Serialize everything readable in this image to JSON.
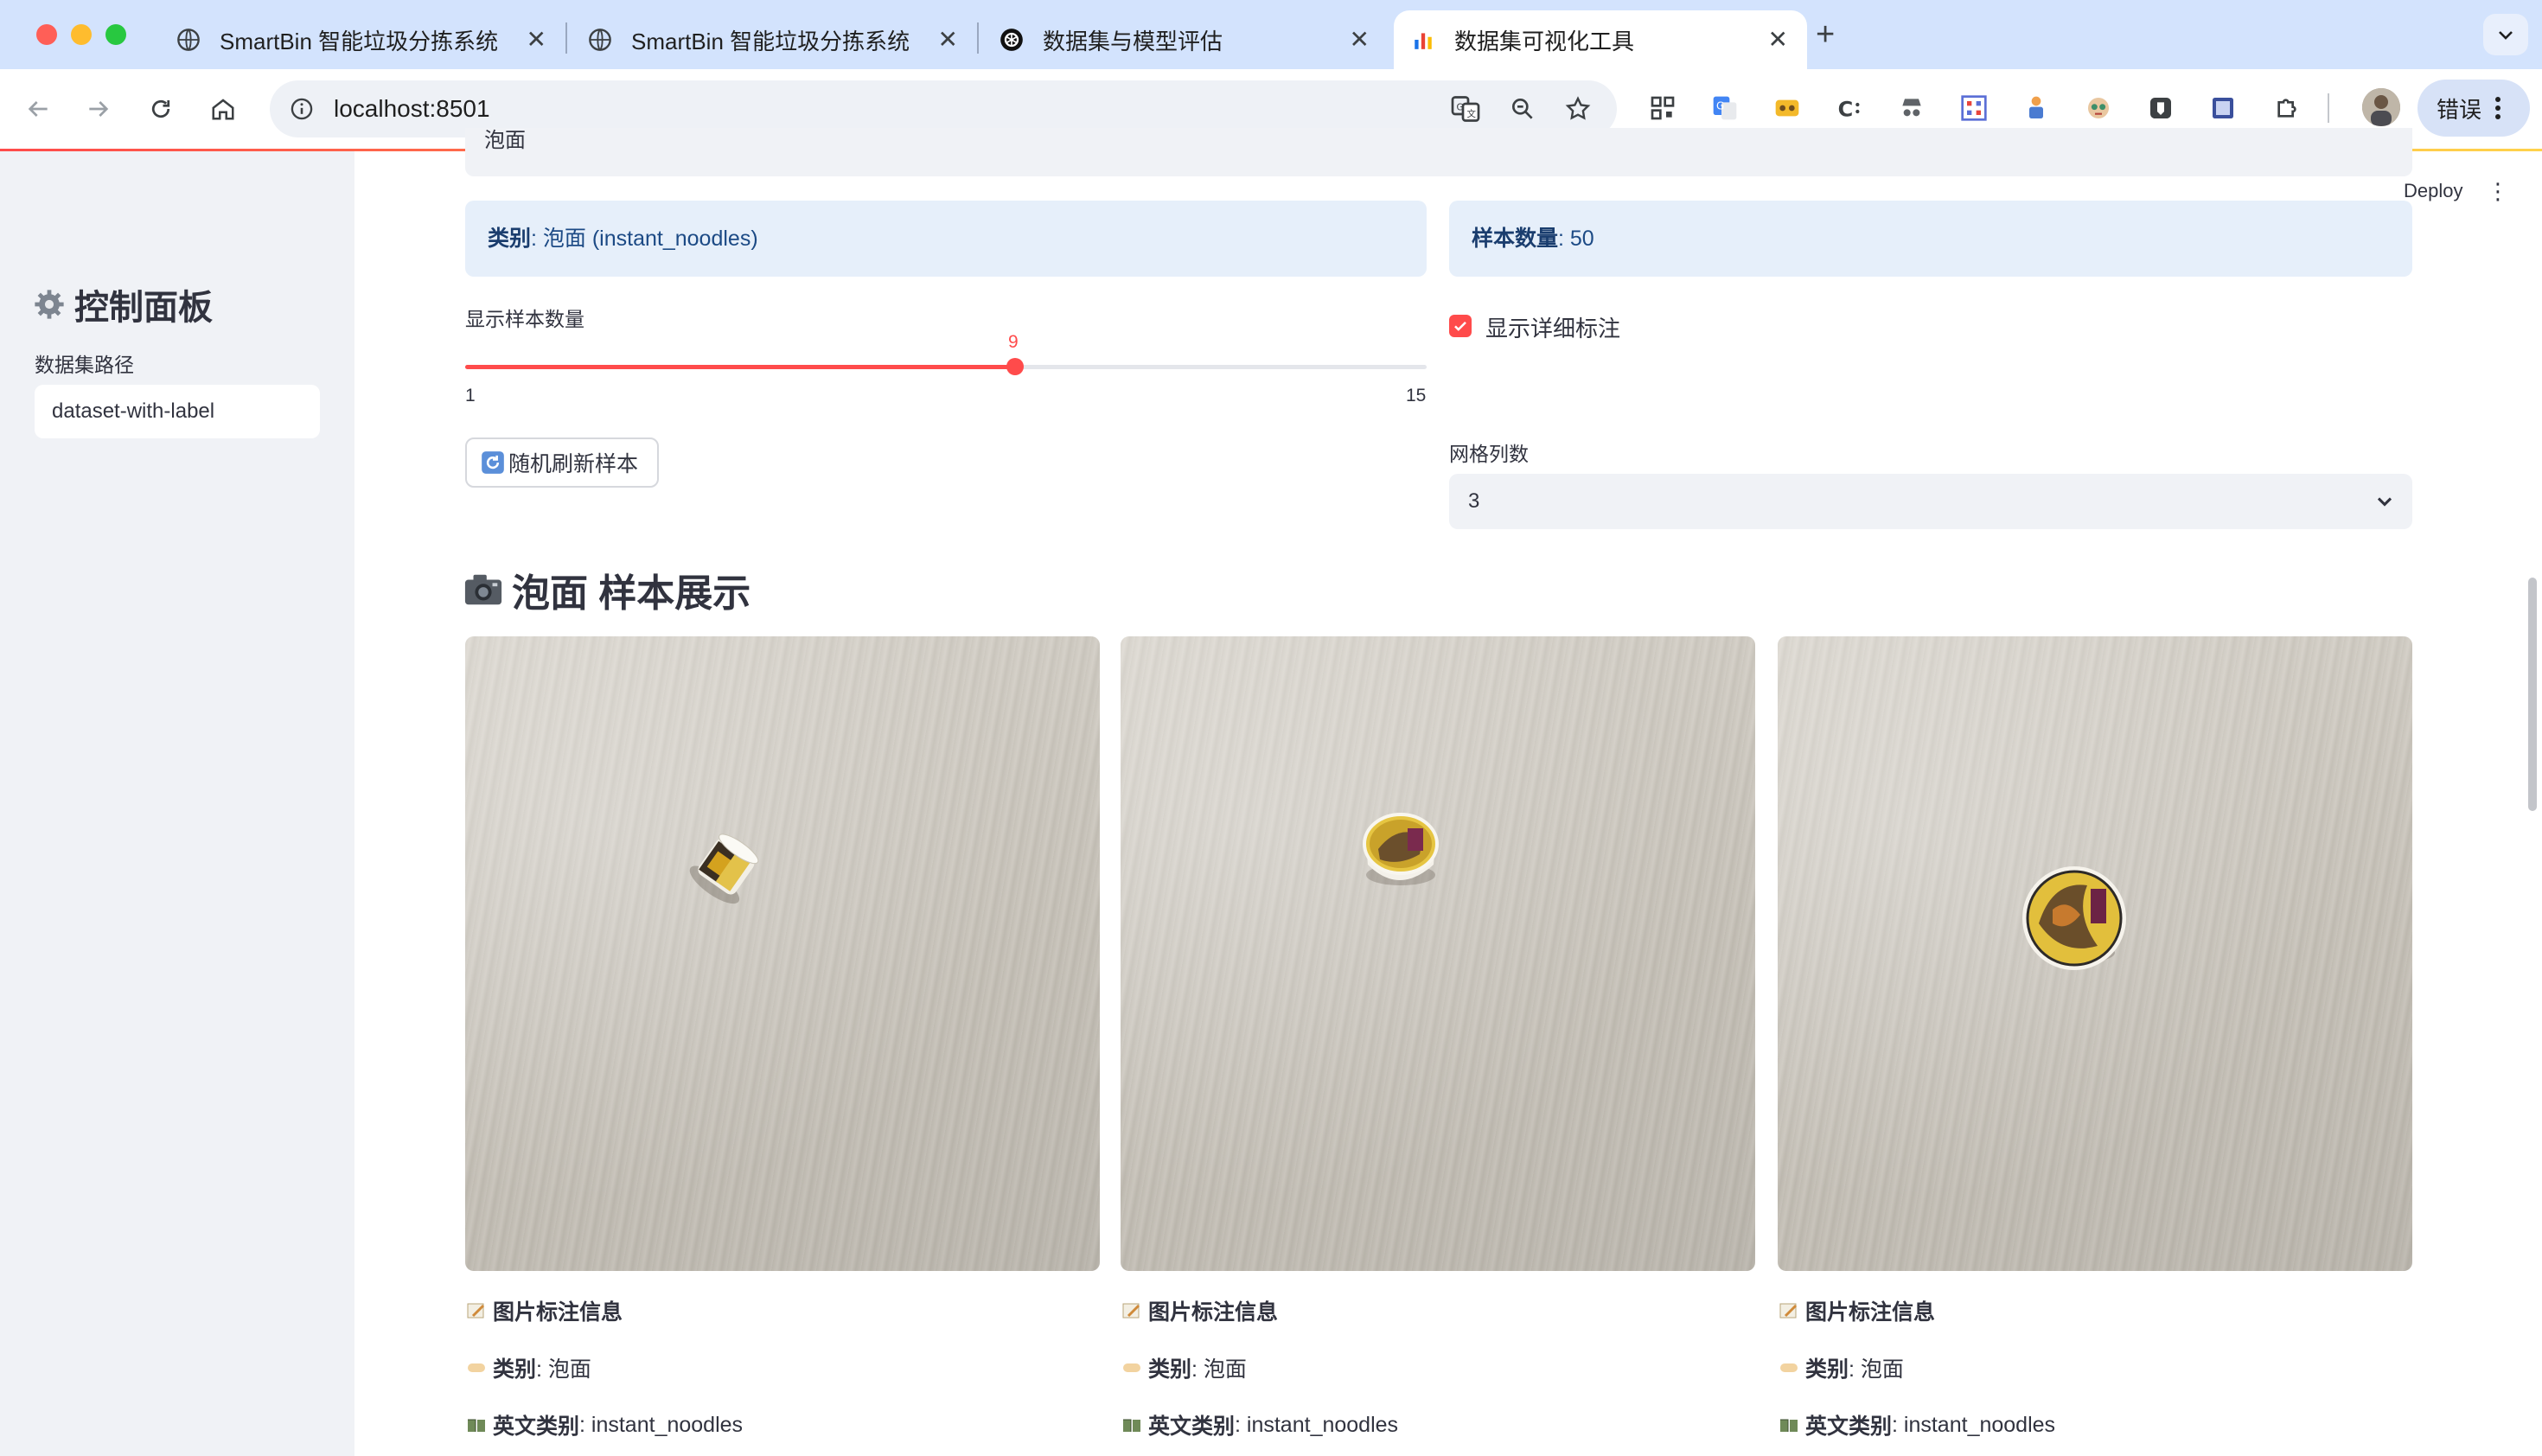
{
  "browser": {
    "tabs": [
      {
        "title": "SmartBin 智能垃圾分拣系统",
        "icon": "globe-icon"
      },
      {
        "title": "SmartBin 智能垃圾分拣系统",
        "icon": "globe-icon"
      },
      {
        "title": "数据集与模型评估",
        "icon": "openai-icon"
      },
      {
        "title": "数据集可视化工具",
        "icon": "bar-chart-icon",
        "active": true
      }
    ],
    "url": "localhost:8501",
    "error_button": "错误"
  },
  "app": {
    "deploy_label": "Deploy",
    "top_select_value": "泡面",
    "sidebar": {
      "title": "控制面板",
      "path_label": "数据集路径",
      "path_value": "dataset-with-label"
    },
    "info": {
      "category_key": "类别",
      "category_value": ": 泡面 (instant_noodles)",
      "count_key": "样本数量",
      "count_value": ": 50"
    },
    "slider": {
      "label": "显示样本数量",
      "value": "9",
      "min": "1",
      "max": "15"
    },
    "checkbox": {
      "label": "显示详细标注",
      "checked": true
    },
    "refresh_button": "随机刷新样本",
    "grid": {
      "label": "网格列数",
      "value": "3"
    },
    "section_title": "泡面 样本展示",
    "samples": [
      {
        "info_title": "图片标注信息",
        "category_key": "类别",
        "category_value": ": 泡面",
        "en_key": "英文类别",
        "en_value": ": instant_noodles"
      },
      {
        "info_title": "图片标注信息",
        "category_key": "类别",
        "category_value": ": 泡面",
        "en_key": "英文类别",
        "en_value": ": instant_noodles"
      },
      {
        "info_title": "图片标注信息",
        "category_key": "类别",
        "category_value": ": 泡面",
        "en_key": "英文类别",
        "en_value": ": instant_noodles"
      }
    ]
  },
  "colors": {
    "accent": "#ff4b4b",
    "info_bg": "#e6effa",
    "sidebar_bg": "#f0f2f6",
    "tabbar_bg": "#d3e3fd"
  }
}
